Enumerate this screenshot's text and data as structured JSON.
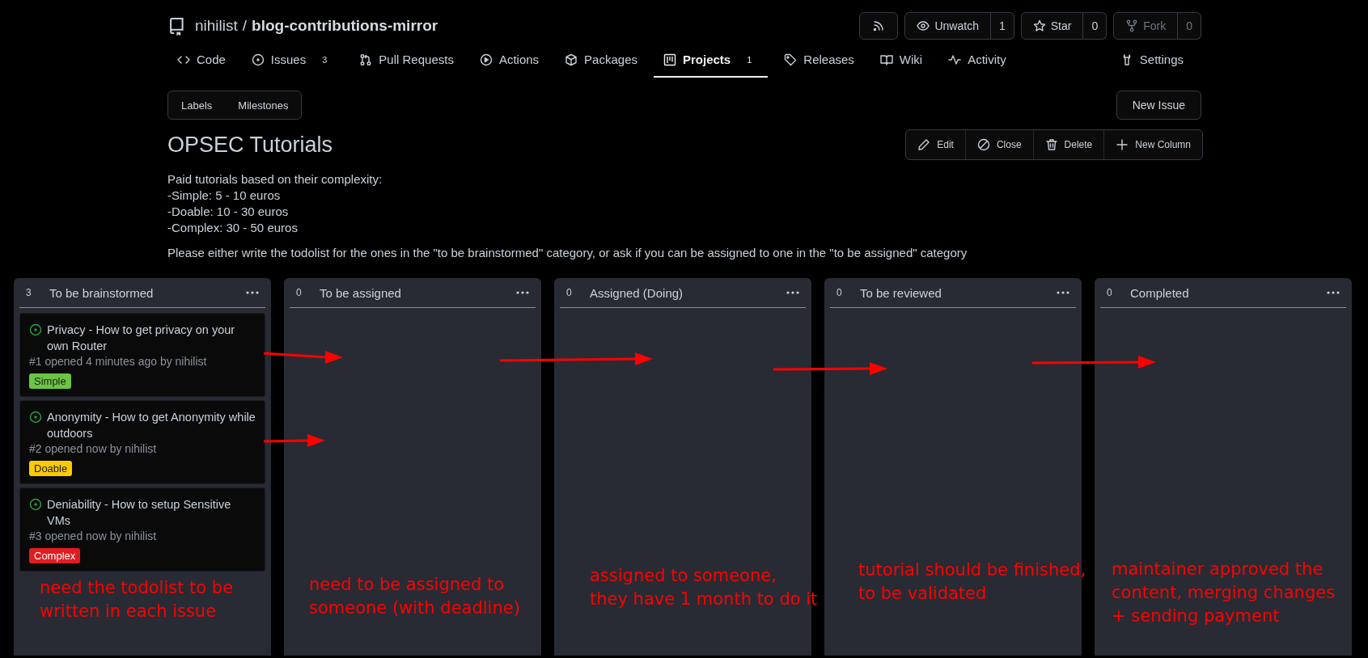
{
  "repo": {
    "owner": "nihilist",
    "separator": "/",
    "name": "blog-contributions-mirror"
  },
  "repo_actions": [
    {
      "kind": "icon",
      "disabled": false
    },
    {
      "kind": "counter",
      "label": "Unwatch",
      "count": "1",
      "disabled": false
    },
    {
      "kind": "counter",
      "label": "Star",
      "count": "0",
      "disabled": false
    },
    {
      "kind": "counter",
      "label": "Fork",
      "count": "0",
      "disabled": true
    }
  ],
  "tabs": [
    {
      "label": "Code",
      "selected": false
    },
    {
      "label": "Issues",
      "count": "3",
      "selected": false
    },
    {
      "label": "Pull Requests",
      "selected": false
    },
    {
      "label": "Actions",
      "selected": false
    },
    {
      "label": "Packages",
      "selected": false
    },
    {
      "label": "Projects",
      "count": "1",
      "selected": true
    },
    {
      "label": "Releases",
      "selected": false
    },
    {
      "label": "Wiki",
      "selected": false
    },
    {
      "label": "Activity",
      "selected": false
    },
    {
      "label": "Settings",
      "selected": false
    }
  ],
  "subnav": [
    "Labels",
    "Milestones"
  ],
  "new_issue": "New Issue",
  "project": {
    "title": "OPSEC Tutorials",
    "description": [
      "Paid tutorials based on their complexity:",
      "-Simple: 5 - 10 euros",
      "-Doable: 10 - 30 euros",
      "-Complex: 30 - 50 euros"
    ],
    "note": "Please either write the todolist for the ones in the \"to be brainstormed\" category, or ask if you can be assigned to one in the \"to be assigned\" category",
    "actions": [
      "Edit",
      "Close",
      "Delete",
      "New Column"
    ]
  },
  "columns": [
    {
      "count": "3",
      "title": "To be brainstormed",
      "cards": [
        {
          "title": "Privacy - How to get privacy on your own Router",
          "meta": "#1 opened 4 minutes ago by nihilist",
          "label": "Simple",
          "color": "#6cc644"
        },
        {
          "title": "Anonymity - How to get Anonymity while outdoors",
          "meta": "#2 opened now by nihilist",
          "label": "Doable",
          "color": "#fbca04"
        },
        {
          "title": "Deniability - How to setup Sensitive VMs",
          "meta": "#3 opened now by nihilist",
          "label": "Complex",
          "color": "#e11d21"
        }
      ],
      "annotation": [
        "need the todolist to be",
        "written in each issue"
      ]
    },
    {
      "count": "0",
      "title": "To be assigned",
      "annotation": [
        "need to be assigned to",
        "someone (with deadline)"
      ]
    },
    {
      "count": "0",
      "title": "Assigned (Doing)",
      "annotation": [
        "assigned to someone,",
        "they have 1 month to do it"
      ]
    },
    {
      "count": "0",
      "title": "To be reviewed",
      "annotation": [
        "tutorial should be finished,",
        "to be validated"
      ]
    },
    {
      "count": "0",
      "title": "Completed",
      "annotation": [
        "maintainer approved the",
        "content, merging changes",
        "+ sending payment"
      ]
    }
  ]
}
